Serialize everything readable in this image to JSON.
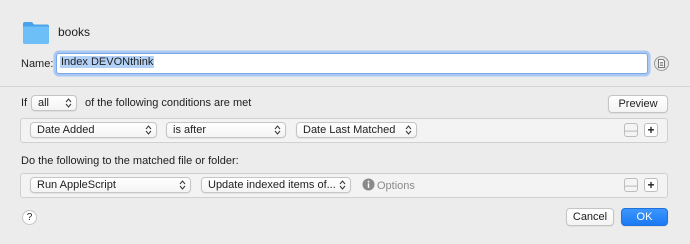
{
  "header": {
    "folder_icon": "folder-icon",
    "folder_name": "books"
  },
  "name_field": {
    "label": "Name:",
    "value": "Index DEVONthink",
    "icon": "document-icon"
  },
  "conditions": {
    "prefix": "If",
    "match_value": "all",
    "suffix": "of the following conditions are met",
    "preview_label": "Preview",
    "rows": [
      {
        "attribute": "Date Added",
        "operator": "is after",
        "value": "Date Last Matched"
      }
    ]
  },
  "actions": {
    "heading": "Do the following to the matched file or folder:",
    "rows": [
      {
        "action": "Run AppleScript",
        "script": "Update indexed items of...",
        "options_label": "Options"
      }
    ]
  },
  "footer": {
    "help_label": "?",
    "cancel_label": "Cancel",
    "ok_label": "OK"
  },
  "controls": {
    "minus": "—",
    "plus": "+"
  },
  "colors": {
    "accent": "#1a7af4",
    "background": "#ececec",
    "folder": "#5ab4f2"
  }
}
